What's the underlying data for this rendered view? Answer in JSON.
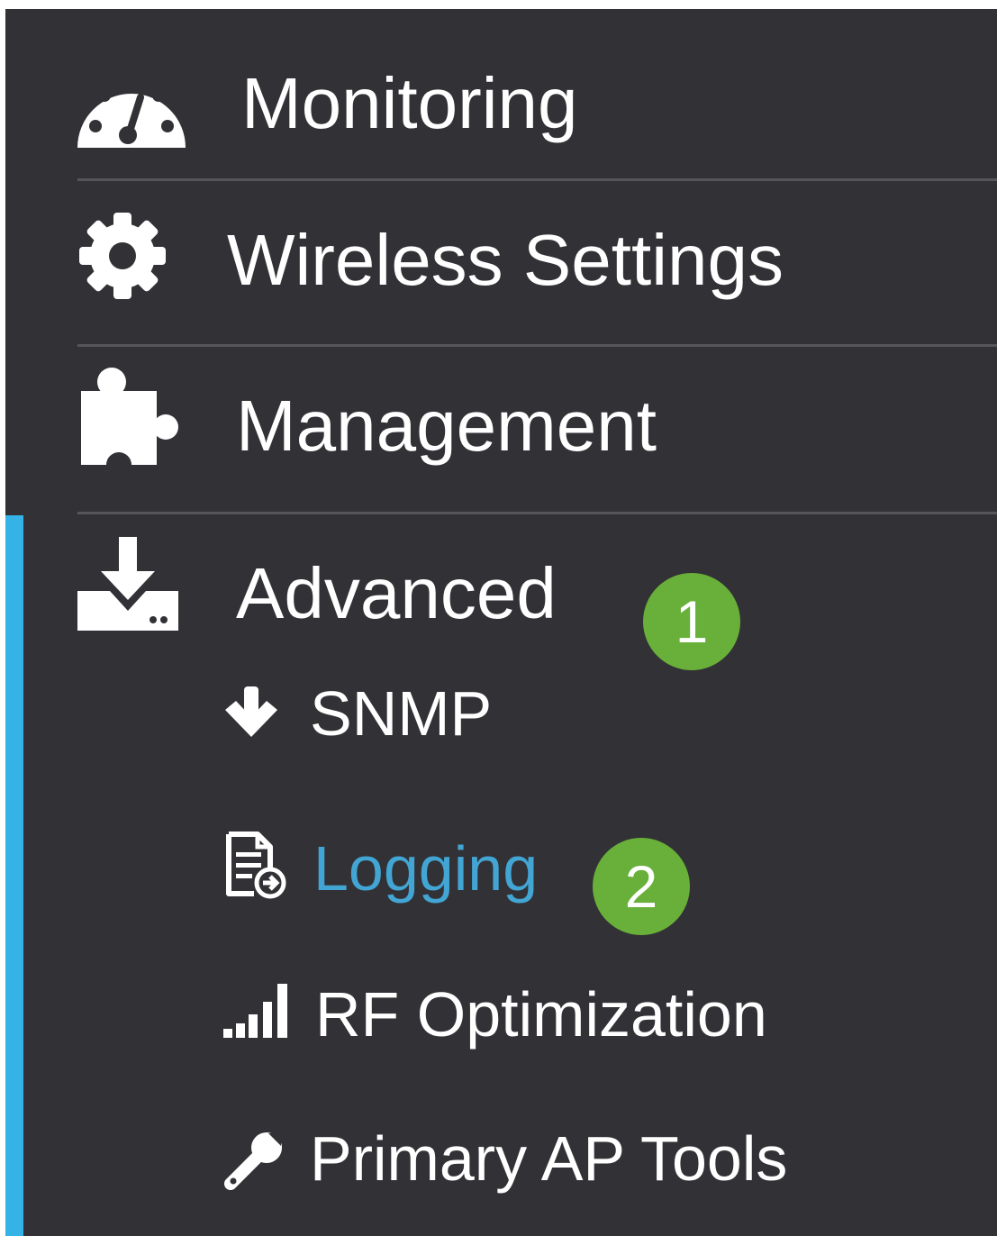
{
  "menu": {
    "items": [
      {
        "label": "Monitoring",
        "icon": "dashboard-gauge-icon"
      },
      {
        "label": "Wireless Settings",
        "icon": "gear-icon"
      },
      {
        "label": "Management",
        "icon": "puzzle-piece-icon"
      },
      {
        "label": "Advanced",
        "icon": "download-tray-icon",
        "badge": "1",
        "active": true
      }
    ],
    "submenu": [
      {
        "label": "SNMP",
        "icon": "arrow-down-icon"
      },
      {
        "label": "Logging",
        "icon": "document-log-icon",
        "badge": "2",
        "active": true
      },
      {
        "label": "RF Optimization",
        "icon": "signal-bars-icon"
      },
      {
        "label": "Primary AP Tools",
        "icon": "wrench-icon"
      }
    ]
  },
  "colors": {
    "background": "#323136",
    "active_bar": "#35b3e6",
    "active_text": "#42a5d3",
    "badge": "#68b039",
    "text": "#ffffff"
  }
}
